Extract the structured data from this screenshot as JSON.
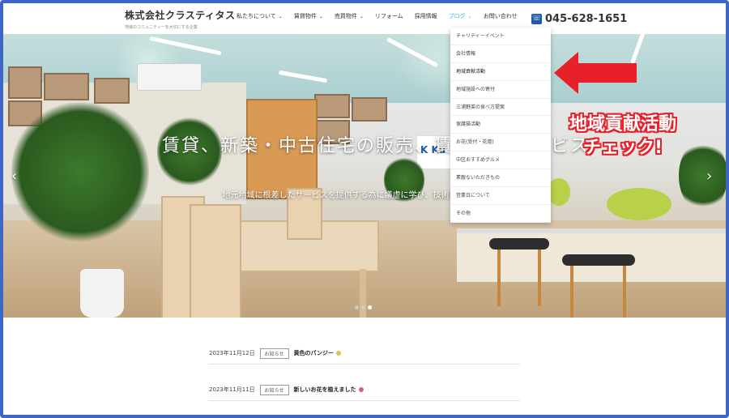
{
  "header": {
    "company_name": "株式会社クラスティタス",
    "tagline": "地域のコミュニティーを大切にする企業",
    "nav": [
      {
        "label": "私たちについて",
        "has_dropdown": true
      },
      {
        "label": "賃貸物件",
        "has_dropdown": true
      },
      {
        "label": "売買物件",
        "has_dropdown": true
      },
      {
        "label": "リフォーム",
        "has_dropdown": false
      },
      {
        "label": "採用情報",
        "has_dropdown": false
      },
      {
        "label": "ブログ",
        "has_dropdown": true,
        "active": true
      },
      {
        "label": "お問い合わせ",
        "has_dropdown": false
      }
    ],
    "phone": "045-628-1651",
    "phone_icon": "phone-icon"
  },
  "dropdown": {
    "items": [
      "チャリティーイベント",
      "会社情報",
      "地域貢献活動",
      "地域施設への寄付",
      "三浦野菜の食べ方提案",
      "保護猫活動",
      "お花(受付・花壇)",
      "中区おすすめグルメ",
      "素敵ないただきもの",
      "営業日について",
      "その他"
    ]
  },
  "hero": {
    "title": "賃貸、新築・中古住宅の販売、賃貸管理サービス",
    "subtitle": "地元地域に根差したサービスを提供する為に議虚に学び、技術を磨き続けます。",
    "sign_text": "K Ku",
    "prev_icon": "chevron-left-icon",
    "next_icon": "chevron-right-icon",
    "slides": 3,
    "active_slide": 3
  },
  "annotation": {
    "line1": "地域貢献活動",
    "line2": "チェック!",
    "color": "#e8202a"
  },
  "news": [
    {
      "date": "2023年11月12日",
      "category": "お知らせ",
      "title": "黄色のパンジー"
    },
    {
      "date": "2023年11月11日",
      "category": "お知らせ",
      "title": "新しいお花を植えました"
    }
  ],
  "colors": {
    "frame": "#3e66c4",
    "active_nav": "#4aa3df",
    "brand_blue": "#1f5aa6"
  }
}
